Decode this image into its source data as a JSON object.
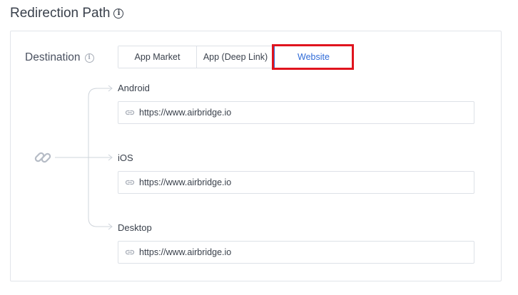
{
  "header": {
    "title": "Redirection Path",
    "info_icon": "info-icon"
  },
  "destination": {
    "label": "Destination",
    "info_icon": "info-icon",
    "tabs": [
      {
        "label": "App Market",
        "active": false
      },
      {
        "label": "App (Deep Link)",
        "active": false
      },
      {
        "label": "Website",
        "active": true
      }
    ],
    "highlight_color": "#e0141e",
    "active_color": "#2f6bd8"
  },
  "platforms": [
    {
      "label": "Android",
      "url": "https://www.airbridge.io",
      "icon": "link-icon"
    },
    {
      "label": "iOS",
      "url": "https://www.airbridge.io",
      "icon": "link-icon"
    },
    {
      "label": "Desktop",
      "url": "https://www.airbridge.io",
      "icon": "link-icon"
    }
  ],
  "tree_icon": "chain-link-icon"
}
